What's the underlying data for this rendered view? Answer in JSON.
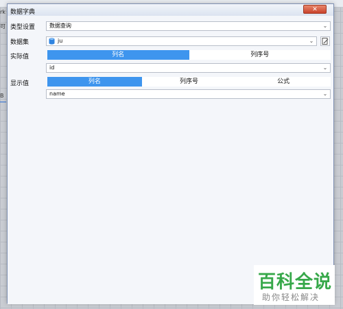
{
  "dialog": {
    "title": "数据字典",
    "close_label": "✕"
  },
  "type_setting": {
    "label": "类型设置",
    "value": "数据查询"
  },
  "dataset": {
    "label": "数据集",
    "value": "ju"
  },
  "actual_value": {
    "label": "实际值",
    "tabs": [
      "列名",
      "列序号"
    ],
    "active_tab": "列名",
    "field_value": "id"
  },
  "display_value": {
    "label": "显示值",
    "tabs": [
      "列名",
      "列序号",
      "公式"
    ],
    "active_tab": "列名",
    "field_value": "name"
  },
  "background": {
    "left_texts": [
      "rk",
      "可",
      "B"
    ]
  },
  "watermark": {
    "main": "百科全说",
    "sub": "助你轻松解决"
  },
  "colors": {
    "accent": "#3e95ee",
    "close": "#c9432c",
    "watermark": "#37a84a"
  }
}
